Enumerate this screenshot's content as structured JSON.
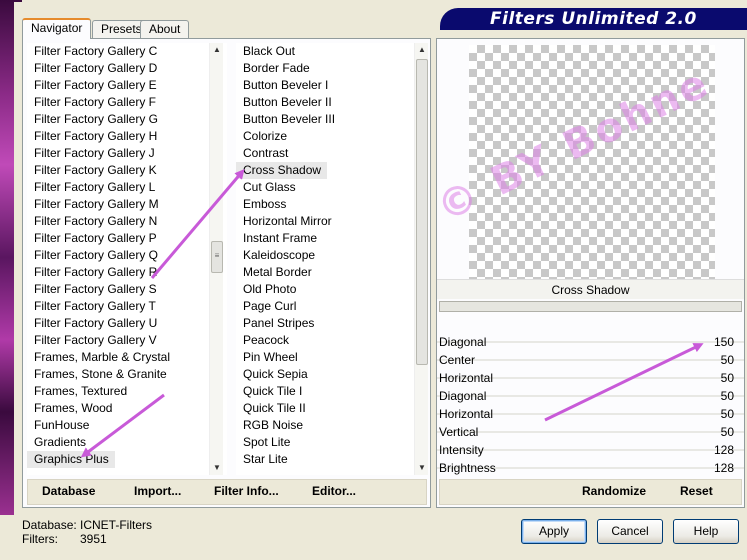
{
  "window": {
    "title": "Filters Unlimited 2.0"
  },
  "tabs": [
    {
      "label": "Navigator",
      "active": true
    },
    {
      "label": "Presets",
      "active": false
    },
    {
      "label": "About",
      "active": false
    }
  ],
  "categories": [
    "Filter Factory Gallery C",
    "Filter Factory Gallery D",
    "Filter Factory Gallery E",
    "Filter Factory Gallery F",
    "Filter Factory Gallery G",
    "Filter Factory Gallery H",
    "Filter Factory Gallery J",
    "Filter Factory Gallery K",
    "Filter Factory Gallery L",
    "Filter Factory Gallery M",
    "Filter Factory Gallery N",
    "Filter Factory Gallery P",
    "Filter Factory Gallery Q",
    "Filter Factory Gallery R",
    "Filter Factory Gallery S",
    "Filter Factory Gallery T",
    "Filter Factory Gallery U",
    "Filter Factory Gallery V",
    "Frames, Marble & Crystal",
    "Frames, Stone & Granite",
    "Frames, Textured",
    "Frames, Wood",
    "FunHouse",
    "Gradients",
    "Graphics Plus"
  ],
  "selected_category": "Graphics Plus",
  "filters": [
    "Black Out",
    "Border Fade",
    "Button Beveler I",
    "Button Beveler II",
    "Button Beveler III",
    "Colorize",
    "Contrast",
    "Cross Shadow",
    "Cut Glass",
    "Emboss",
    "Horizontal Mirror",
    "Instant Frame",
    "Kaleidoscope",
    "Metal Border",
    "Old Photo",
    "Page Curl",
    "Panel Stripes",
    "Peacock",
    "Pin Wheel",
    "Quick Sepia",
    "Quick Tile I",
    "Quick Tile II",
    "RGB Noise",
    "Spot Lite",
    "Star Lite"
  ],
  "selected_filter": "Cross Shadow",
  "left_toolbar": {
    "database": "Database",
    "import": "Import...",
    "filter_info": "Filter Info...",
    "editor": "Editor..."
  },
  "preview": {
    "filter_name": "Cross Shadow"
  },
  "parameters": [
    {
      "label": "Diagonal",
      "value": "150"
    },
    {
      "label": "Center",
      "value": "50"
    },
    {
      "label": "Horizontal",
      "value": "50"
    },
    {
      "label": "Diagonal",
      "value": "50"
    },
    {
      "label": "Horizontal",
      "value": "50"
    },
    {
      "label": "Vertical",
      "value": "50"
    },
    {
      "label": "Intensity",
      "value": "128"
    },
    {
      "label": "Brightness",
      "value": "128"
    }
  ],
  "right_toolbar": {
    "randomize": "Randomize",
    "reset": "Reset"
  },
  "footer": {
    "database_label": "Database:",
    "database_value": "ICNET-Filters",
    "filters_label": "Filters:",
    "filters_value": "3951"
  },
  "buttons": {
    "apply": "Apply",
    "cancel": "Cancel",
    "help": "Help"
  },
  "watermark": "© BY Bohne",
  "colors": {
    "title_bar": "#0a0a6e",
    "arrow": "#c85ad8",
    "watermark": "#dc82e6"
  }
}
